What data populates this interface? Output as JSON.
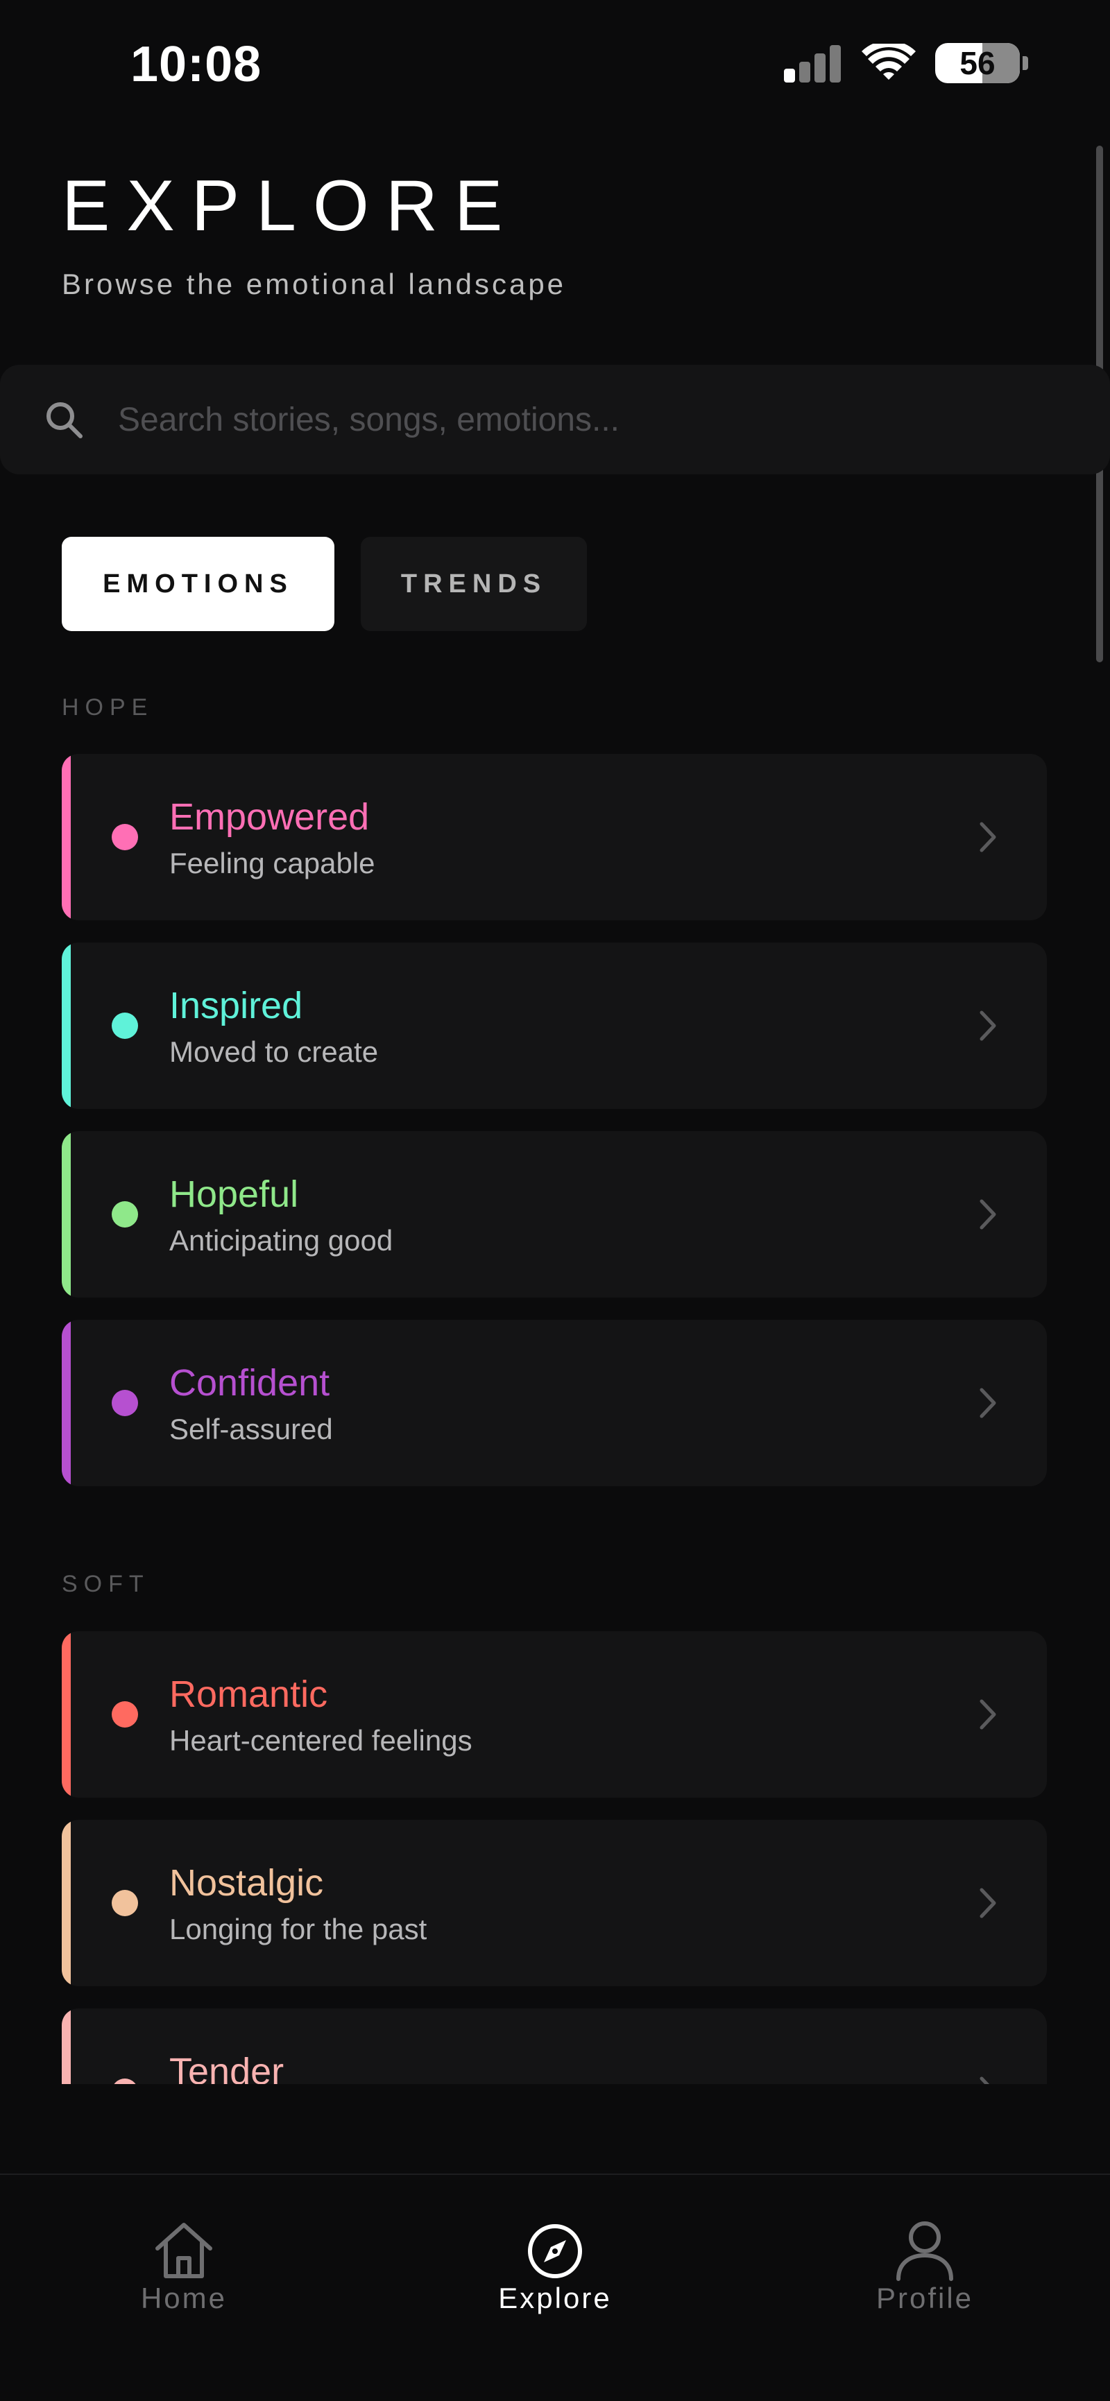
{
  "status_bar": {
    "time": "10:08",
    "battery_level": "56",
    "battery_fraction": 0.56,
    "signal_bars_active": 1,
    "signal_bars_total": 4
  },
  "header": {
    "title": "EXPLORE",
    "subtitle": "Browse the emotional landscape"
  },
  "search": {
    "placeholder": "Search stories, songs, emotions...",
    "value": "",
    "icon": "search-icon"
  },
  "tabs": [
    {
      "label": "EMOTIONS",
      "active": true
    },
    {
      "label": "TRENDS",
      "active": false
    }
  ],
  "sections": [
    {
      "label": "HOPE",
      "items": [
        {
          "name": "Empowered",
          "description": "Feeling capable",
          "color": "#ff6fb5"
        },
        {
          "name": "Inspired",
          "description": "Moved to create",
          "color": "#5ff2d9"
        },
        {
          "name": "Hopeful",
          "description": "Anticipating good",
          "color": "#8fe88a"
        },
        {
          "name": "Confident",
          "description": "Self-assured",
          "color": "#b650d0"
        }
      ]
    },
    {
      "label": "SOFT",
      "items": [
        {
          "name": "Romantic",
          "description": "Heart-centered feelings",
          "color": "#ff6a60"
        },
        {
          "name": "Nostalgic",
          "description": "Longing for the past",
          "color": "#f1c29c"
        },
        {
          "name": "Tender",
          "description": "",
          "color": "#f9b3b1"
        }
      ]
    }
  ],
  "bottom_nav": [
    {
      "label": "Home",
      "icon": "home-icon",
      "active": false
    },
    {
      "label": "Explore",
      "icon": "compass-icon",
      "active": true
    },
    {
      "label": "Profile",
      "icon": "person-icon",
      "active": false
    }
  ],
  "colors": {
    "background": "#0b0b0c",
    "card": "#141415",
    "muted_text": "#b7b7b9",
    "section_label": "#5a5a5c",
    "nav_inactive": "#6e6e70",
    "nav_active": "#ffffff"
  }
}
